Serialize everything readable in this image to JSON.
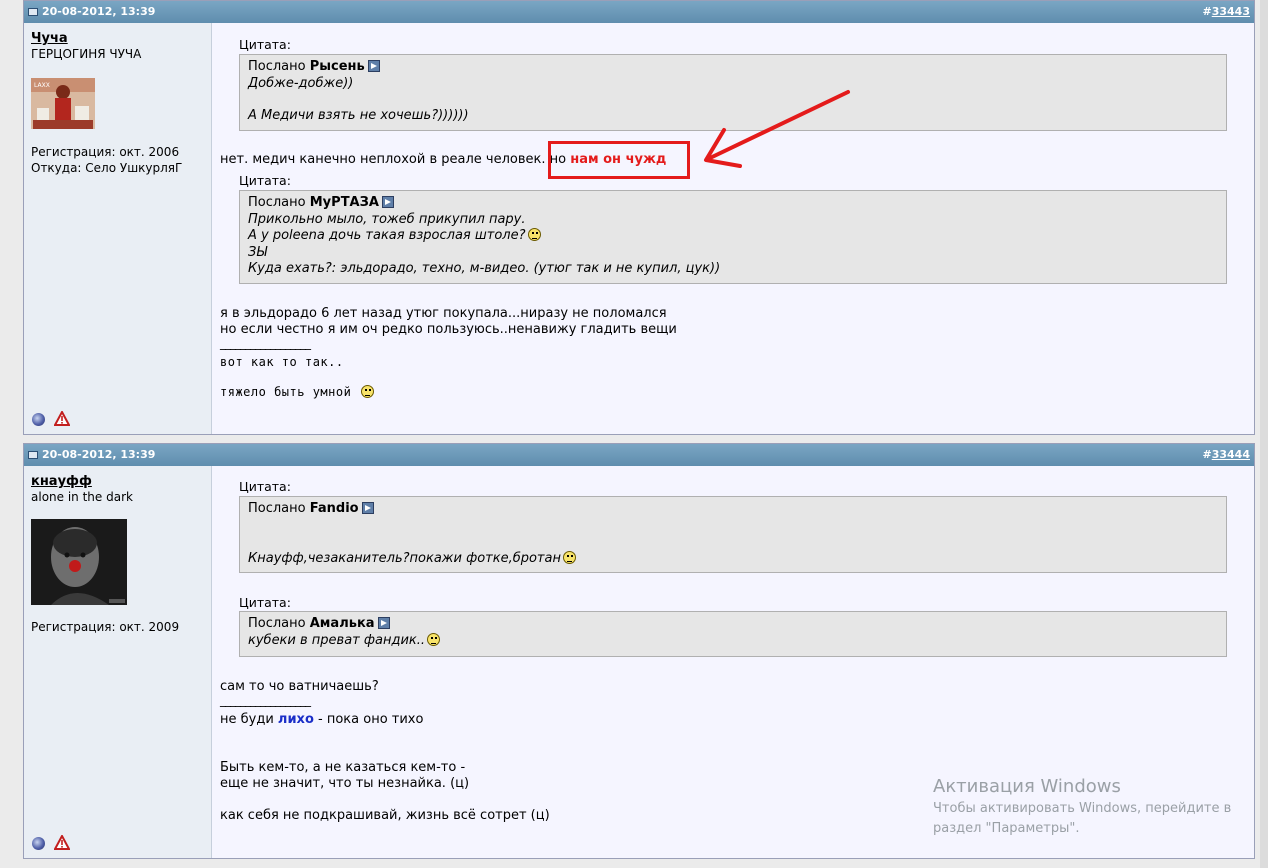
{
  "post1": {
    "date": "20-08-2012, 13:39",
    "number": "33443",
    "user": {
      "name": "Чуча",
      "title": "ГЕРЦОГИНЯ ЧУЧА",
      "registration": "Регистрация: окт. 2006",
      "from": "Откуда: Село УшкурляГ"
    },
    "quote1": {
      "label": "Цитата:",
      "posted_by": "Послано",
      "author": "Рысень",
      "lines": [
        "Добже-добже))",
        "А Медичи взять не хочешь?))))))"
      ]
    },
    "reply1": {
      "before": "нет. медич канечно неплохой в реале человек. но ",
      "highlight": "нам он чужд"
    },
    "quote2": {
      "label": "Цитата:",
      "posted_by": "Послано",
      "author": "МуРТАЗА",
      "lines": [
        "Прикольно мыло, тожеб прикупил пару.",
        "А у poleena дочь такая взрослая штоле?",
        "ЗЫ",
        "Куда ехать?: эльдорадо, техно, м-видео. (утюг так и не купил, цук))"
      ]
    },
    "text_lines": [
      "я в эльдорадо 6 лет назад утюг покупала...ниразу не поломался",
      "но если честно я им оч редко пользуюсь..ненавижу гладить вещи"
    ],
    "signature": {
      "rule": "__________________",
      "line1": "вот как то так..",
      "line2": "тяжело быть умной"
    }
  },
  "post2": {
    "date": "20-08-2012, 13:39",
    "number": "33444",
    "user": {
      "name": "кнауфф",
      "title": "alone in the dark",
      "registration": "Регистрация: окт. 2009"
    },
    "quote1": {
      "label": "Цитата:",
      "posted_by": "Послано",
      "author": "Fandio",
      "line": "Кнауфф,чезаканитель?покажи фотке,бротан"
    },
    "quote2": {
      "label": "Цитата:",
      "posted_by": "Послано",
      "author": "Амалька",
      "line": "кубеки в преват фандик.."
    },
    "text": "сам то чо ватничаешь?",
    "signature": {
      "rule": "__________________",
      "prefix": "не буди ",
      "highlight": "лихо",
      "suffix": " - пока оно тихо",
      "line2": "Быть кем-то, а не казаться кем-то -",
      "line3": "еще не значит, что ты незнайка. (ц)",
      "line4": "как себя не подкрашивай, жизнь всё сотрет (ц)"
    }
  },
  "watermark": {
    "title": "Активация Windows",
    "line1": "Чтобы активировать Windows, перейдите в",
    "line2": "раздел \"Параметры\"."
  },
  "colors": {
    "header": "#6a97b8",
    "highlight_red": "#e41b1b",
    "highlight_blue": "#1a2ec8"
  }
}
